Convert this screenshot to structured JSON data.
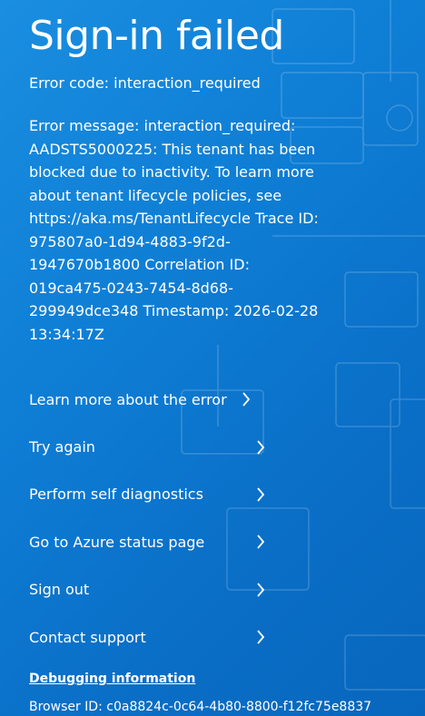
{
  "title": "Sign-in failed",
  "error_code": "Error code: interaction_required",
  "error_message": "Error message: interaction_required: AADSTS5000225: This tenant has been blocked due to inactivity. To learn more about tenant lifecycle policies, see https://aka.ms/TenantLifecycle Trace ID: 975807a0-1d94-4883-9f2d-1947670b1800 Correlation ID: 019ca475-0243-7454-8d68-299949dce348 Timestamp: 2026-02-28 13:34:17Z",
  "links": [
    {
      "label": "Learn more about the error",
      "icon": "chevron-right-icon"
    },
    {
      "label": "Try again",
      "icon": "chevron-right-icon"
    },
    {
      "label": "Perform self diagnostics",
      "icon": "chevron-right-icon"
    },
    {
      "label": "Go to Azure status page",
      "icon": "chevron-right-icon"
    },
    {
      "label": "Sign out",
      "icon": "chevron-right-icon"
    },
    {
      "label": "Contact support",
      "icon": "chevron-right-icon"
    }
  ],
  "debugging": {
    "title": "Debugging information",
    "browser_id": "Browser ID: c0a8824c-0c64-4b80-8800-f12fc75e8837"
  },
  "colors": {
    "background_primary": "#0f7fd6",
    "text": "#ffffff"
  }
}
